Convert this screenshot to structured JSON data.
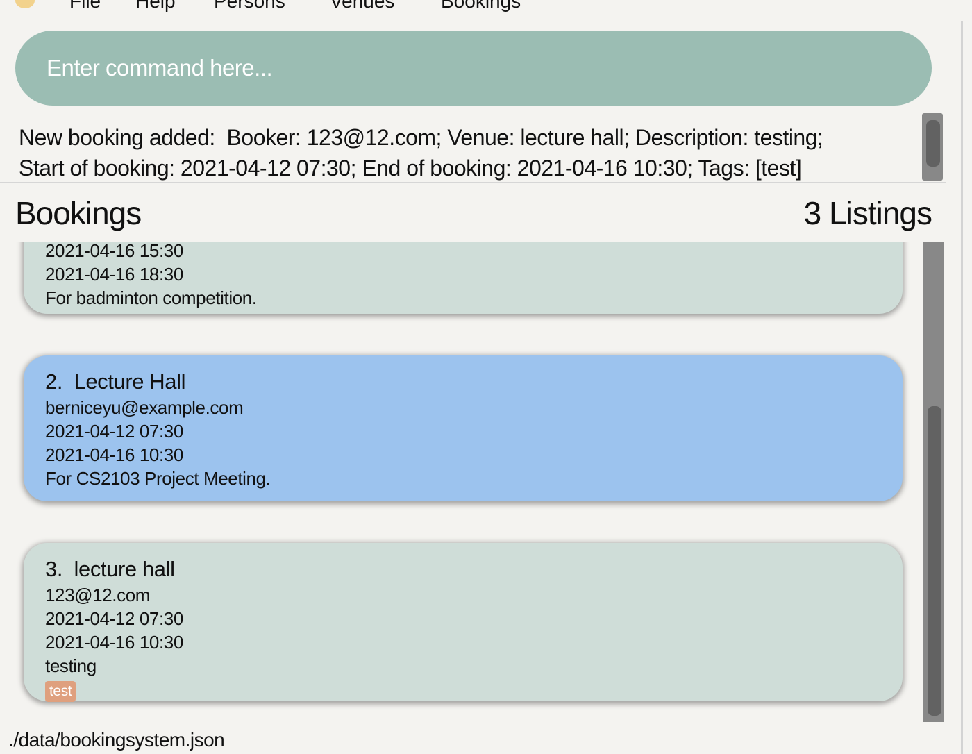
{
  "menu": {
    "items": [
      "File",
      "Help",
      "Persons",
      "Venues",
      "Bookings"
    ]
  },
  "command": {
    "placeholder": "Enter command here...",
    "value": ""
  },
  "result": {
    "line1": "New booking added:  Booker: 123@12.com; Venue: lecture hall; Description: testing;",
    "line2": "Start of booking: 2021-04-12 07:30; End of booking: 2021-04-16 10:30; Tags: [test]"
  },
  "list": {
    "title": "Bookings",
    "count": "3 Listings",
    "cards": [
      {
        "start": "2021-04-16 15:30",
        "end": "2021-04-16 18:30",
        "description": "For badminton competition."
      },
      {
        "index": "2.",
        "venue": "Lecture Hall",
        "booker": "berniceyu@example.com",
        "start": "2021-04-12 07:30",
        "end": "2021-04-16 10:30",
        "description": "For CS2103 Project Meeting.",
        "selected": true
      },
      {
        "index": "3.",
        "venue": "lecture hall",
        "booker": "123@12.com",
        "start": "2021-04-12 07:30",
        "end": "2021-04-16 10:30",
        "description": "testing",
        "tags": [
          "test"
        ]
      }
    ]
  },
  "footer": {
    "path": "./data/bookingsystem.json"
  },
  "colors": {
    "command_bg": "#9bbdb3",
    "card_bg": "#cfddd8",
    "card_selected_bg": "#9cc3ee",
    "tag_bg": "#dfa07e"
  }
}
